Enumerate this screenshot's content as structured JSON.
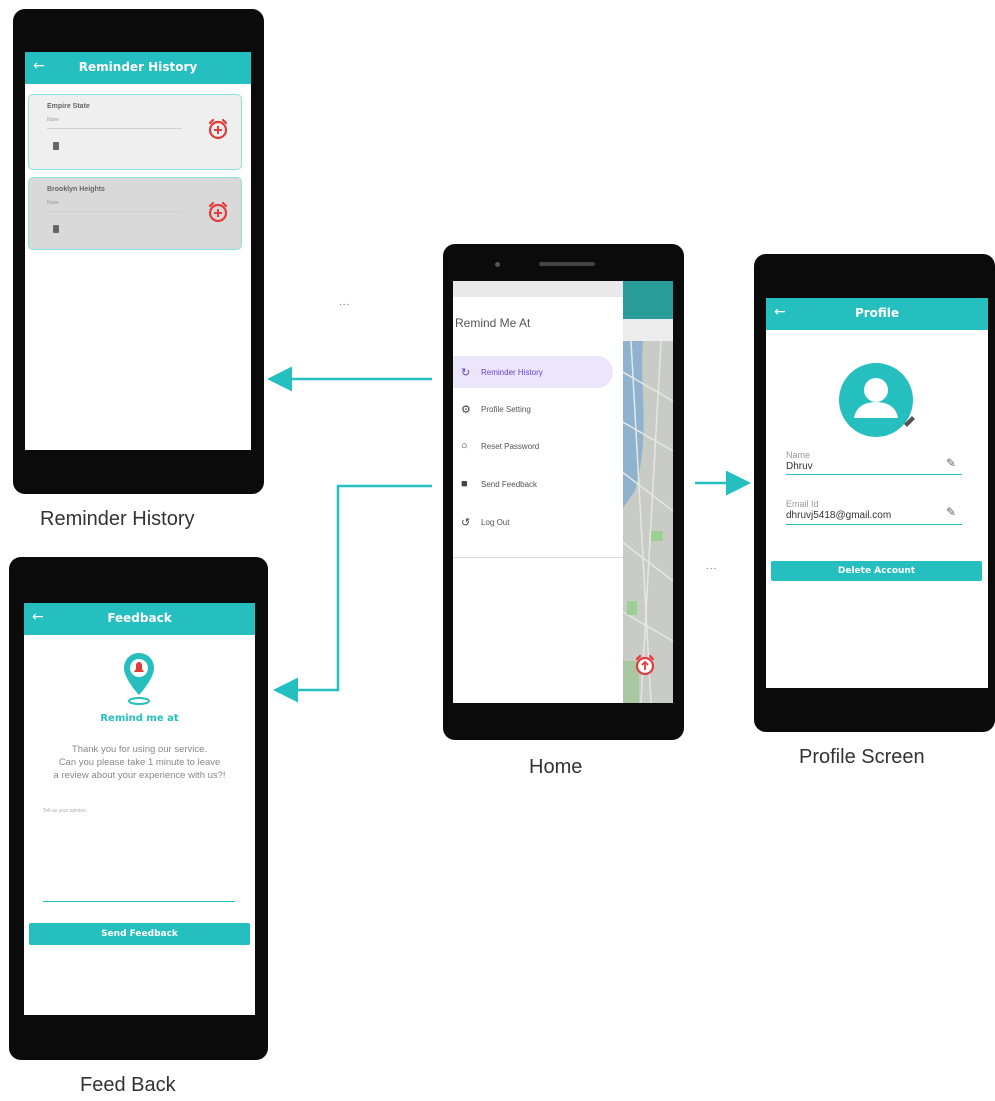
{
  "captions": {
    "reminder_history": "Reminder History",
    "feedback": "Feed Back",
    "home": "Home",
    "profile": "Profile Screen"
  },
  "ellipsis": "...",
  "reminder_history_screen": {
    "back_icon": "arrow-left-icon",
    "title": "Reminder History",
    "cards": [
      {
        "title": "Empire State",
        "note": "None"
      },
      {
        "title": "Brooklyn Heights",
        "note": "None"
      }
    ]
  },
  "home_screen": {
    "drawer_title": "Remind Me At",
    "menu": [
      {
        "label": "Reminder History",
        "icon": "history-icon",
        "active": true
      },
      {
        "label": "Profile Setting",
        "icon": "gear-icon",
        "active": false
      },
      {
        "label": "Reset Password",
        "icon": "reset-icon",
        "active": false
      },
      {
        "label": "Send Feedback",
        "icon": "feedback-icon",
        "active": false
      },
      {
        "label": "Log Out",
        "icon": "logout-icon",
        "active": false
      }
    ]
  },
  "profile_screen": {
    "title": "Profile",
    "name_label": "Name",
    "name_value": "Dhruv",
    "email_label": "Email Id",
    "email_value": "dhruvj5418@gmail.com",
    "delete_button": "Delete Account"
  },
  "feedback_screen": {
    "title": "Feedback",
    "brand": "Remind me at",
    "message_line1": "Thank you for using our service.",
    "message_line2": "Can you please take 1 minute to leave",
    "message_line3": "a review about your experience with us?!",
    "input_placeholder": "Tell us your opinion.",
    "send_button": "Send Feedback"
  },
  "colors": {
    "teal": "#26bfbf",
    "alarm_red": "#e23b3b",
    "drawer_active": "#ece6fb",
    "drawer_active_text": "#6a3fd6"
  }
}
